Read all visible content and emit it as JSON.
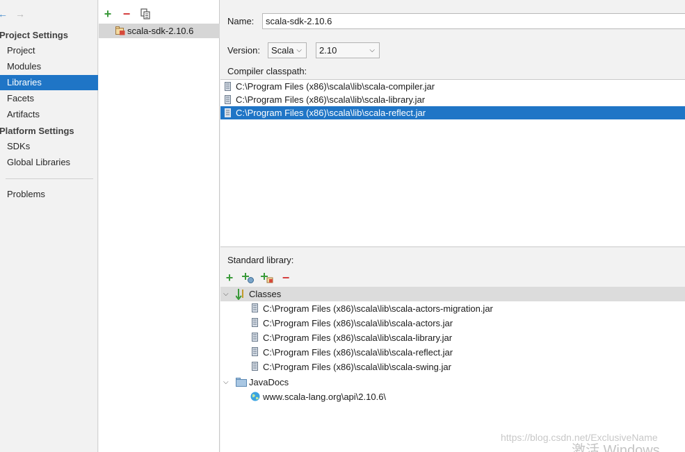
{
  "nav": {
    "back_arrow": "←",
    "forward_arrow": "→",
    "project_settings_header": "Project Settings",
    "project_items": [
      "Project",
      "Modules",
      "Libraries",
      "Facets",
      "Artifacts"
    ],
    "platform_settings_header": "Platform Settings",
    "platform_items": [
      "SDKs",
      "Global Libraries"
    ],
    "problems": "Problems",
    "selected": "Libraries"
  },
  "libraries": {
    "toolbar": {
      "add": "+",
      "remove": "−",
      "copy_icon": "copy-icon"
    },
    "items": [
      "scala-sdk-2.10.6"
    ]
  },
  "details": {
    "name_label": "Name:",
    "name_value": "scala-sdk-2.10.6",
    "version_label": "Version:",
    "version_type": "Scala",
    "version_number": "2.10",
    "compiler_classpath_label": "Compiler classpath:",
    "compiler_classpath": [
      "C:\\Program Files (x86)\\scala\\lib\\scala-compiler.jar",
      "C:\\Program Files (x86)\\scala\\lib\\scala-library.jar",
      "C:\\Program Files (x86)\\scala\\lib\\scala-reflect.jar"
    ],
    "standard_library_label": "Standard library:",
    "std_toolbar": {
      "add": "+",
      "remove": "−"
    },
    "classes_label": "Classes",
    "classes": [
      "C:\\Program Files (x86)\\scala\\lib\\scala-actors-migration.jar",
      "C:\\Program Files (x86)\\scala\\lib\\scala-actors.jar",
      "C:\\Program Files (x86)\\scala\\lib\\scala-library.jar",
      "C:\\Program Files (x86)\\scala\\lib\\scala-reflect.jar",
      "C:\\Program Files (x86)\\scala\\lib\\scala-swing.jar"
    ],
    "javadocs_label": "JavaDocs",
    "javadocs": [
      "www.scala-lang.org\\api\\2.10.6\\"
    ]
  },
  "overlay": {
    "watermark": "https://blog.csdn.net/ExclusiveName",
    "activate": "激活 Windows"
  },
  "colors": {
    "selection": "#1f75c6",
    "add": "#3a9a3a",
    "remove": "#d43c3c"
  }
}
